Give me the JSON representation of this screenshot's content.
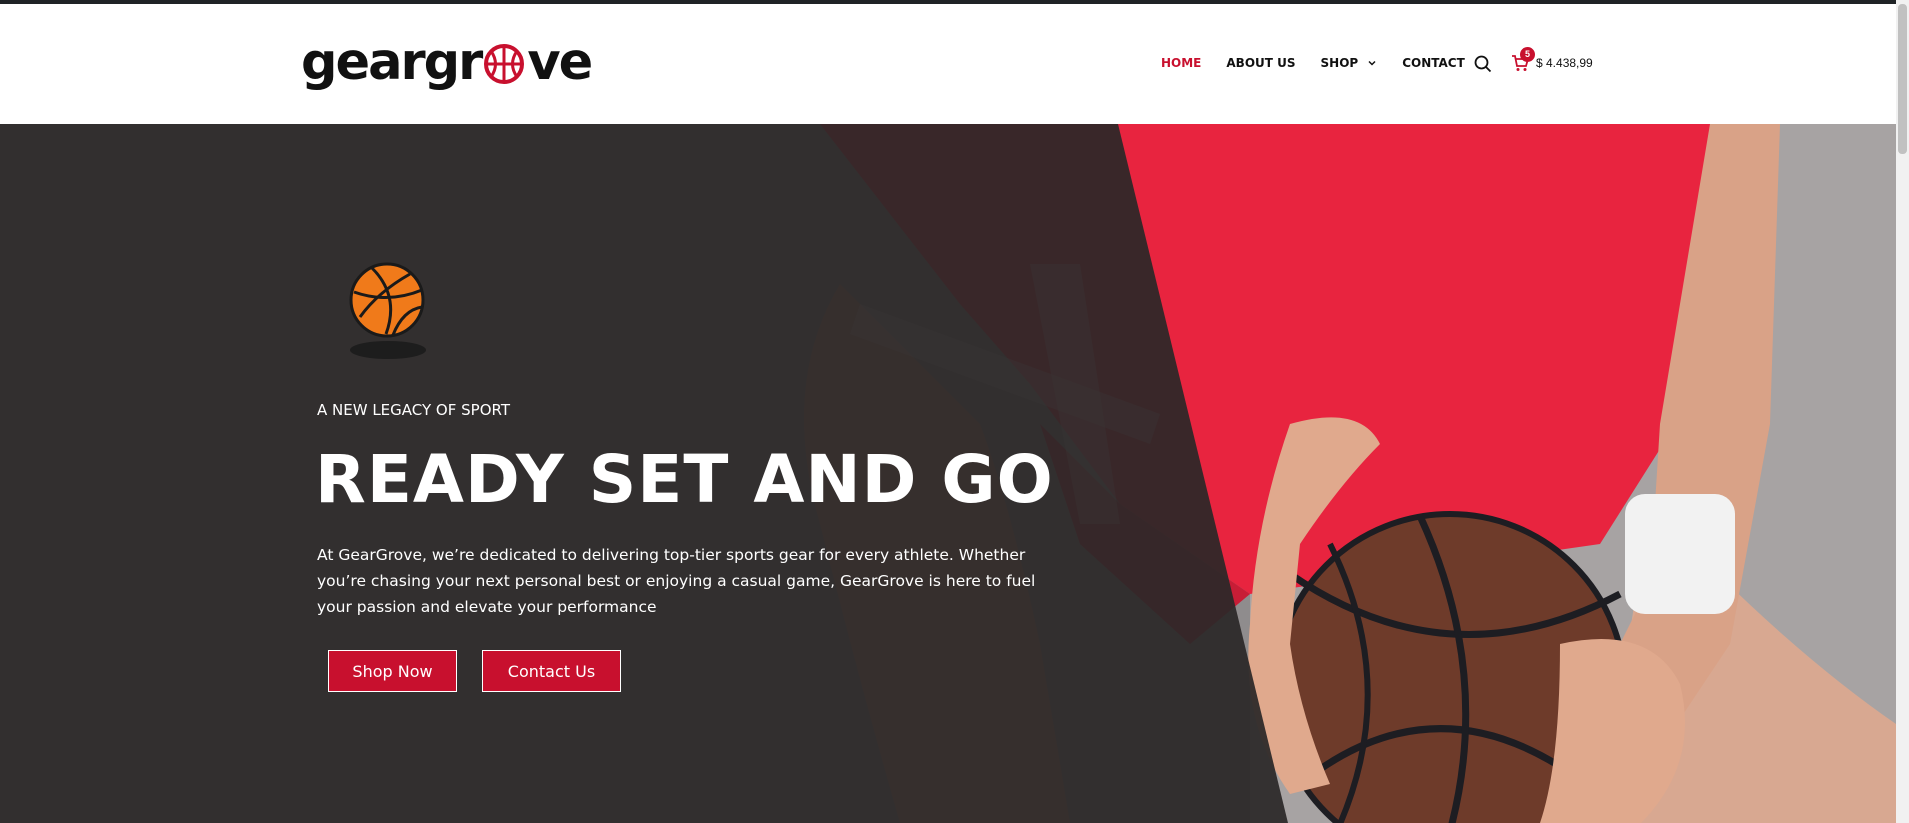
{
  "brand": {
    "logo_left": "geargr",
    "logo_right": "ve",
    "accent_color": "#c8102e"
  },
  "nav": {
    "items": [
      {
        "label": "HOME",
        "active": true
      },
      {
        "label": "ABOUT US",
        "active": false
      },
      {
        "label": "SHOP",
        "active": false,
        "has_dropdown": true
      },
      {
        "label": "CONTACT",
        "active": false
      }
    ]
  },
  "header": {
    "search_icon": "search-icon",
    "cart_icon": "cart-icon",
    "cart_count": "5",
    "cart_total": "$ 4.438,99"
  },
  "hero": {
    "icon": "basketball-icon",
    "tagline": "A NEW LEGACY OF SPORT",
    "headline": "READY SET AND GO",
    "description": "At GearGrove, we’re dedicated to delivering top-tier sports gear for every athlete. Whether you’re chasing your next personal best or enjoying a casual game, GearGrove is here to fuel your passion and elevate your performance",
    "buttons": {
      "shop_label": "Shop Now",
      "contact_label": "Contact Us"
    }
  }
}
